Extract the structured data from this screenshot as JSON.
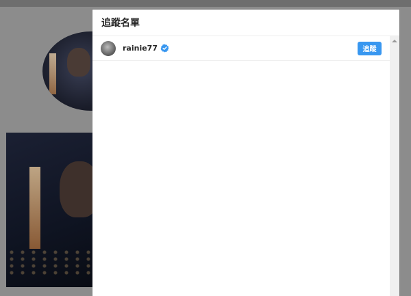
{
  "modal": {
    "title": "追蹤名單"
  },
  "following": [
    {
      "username": "rainie77",
      "verified": true,
      "button_label": "追蹤"
    }
  ],
  "icons": {
    "verified": "verified-badge-icon",
    "scroll_up": "chevron-up-icon"
  },
  "colors": {
    "overlay": "#7a7a7a",
    "follow_button": "#3897f0",
    "verified_badge": "#3897f0"
  }
}
